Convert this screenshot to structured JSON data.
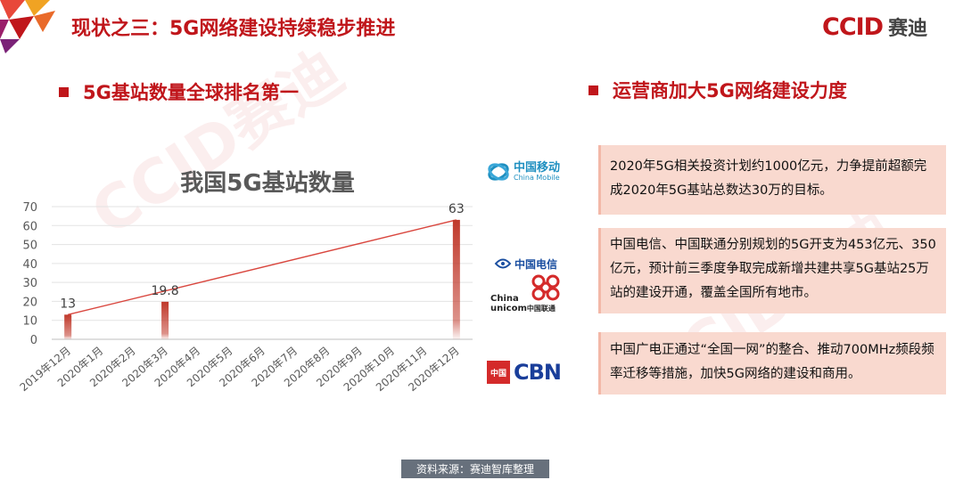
{
  "page": {
    "title": "现状之三：5G网络建设持续稳步推进",
    "logo_mark": "CCID",
    "logo_word": "赛迪",
    "watermark": "CCID赛迪",
    "left_heading": "5G基站数量全球排名第一",
    "right_heading": "运营商加大5G网络建设力度",
    "source": "资料来源：赛迪智库整理",
    "accent_color": "#c0161b"
  },
  "carriers": {
    "china_mobile": {
      "zh": "中国移动",
      "en": "China Mobile"
    },
    "china_telecom": {
      "zh": "中国电信"
    },
    "china_unicom": {
      "en1": "China",
      "en2": "unicom",
      "zh": "中国联通"
    },
    "cbn": {
      "zh": "中国",
      "en": "CBN"
    }
  },
  "cards": [
    {
      "text": "2020年5G相关投资计划约1000亿元，力争提前超额完成2020年5G基站总数达30万的目标。"
    },
    {
      "text": "中国电信、中国联通分别规划的5G开支为453亿元、350亿元，预计前三季度争取完成新增共建共享5G基站25万站的建设开通，覆盖全国所有地市。"
    },
    {
      "text": "中国广电正通过“全国一网”的整合、推动700MHz频段频率迁移等措施，加快5G网络的建设和商用。"
    }
  ],
  "chart_data": {
    "type": "bar",
    "title": "我国5G基站数量",
    "categories": [
      "2019年12月",
      "2020年1月",
      "2020年2月",
      "2020年3月",
      "2020年4月",
      "2020年5月",
      "2020年6月",
      "2020年7月",
      "2020年8月",
      "2020年9月",
      "2020年10月",
      "2020年11月",
      "2020年12月"
    ],
    "values": [
      13,
      null,
      null,
      19.8,
      null,
      null,
      null,
      null,
      null,
      null,
      null,
      null,
      63
    ],
    "value_labels": [
      "13",
      "",
      "",
      "19.8",
      "",
      "",
      "",
      "",
      "",
      "",
      "",
      "",
      "63"
    ],
    "ylim": [
      0,
      70
    ],
    "yticks": [
      "0",
      "10",
      "20",
      "30",
      "40",
      "50",
      "60",
      "70"
    ],
    "trendline": {
      "from": 13,
      "to": 63
    },
    "grid": true,
    "bar_color": "#c0392b"
  }
}
